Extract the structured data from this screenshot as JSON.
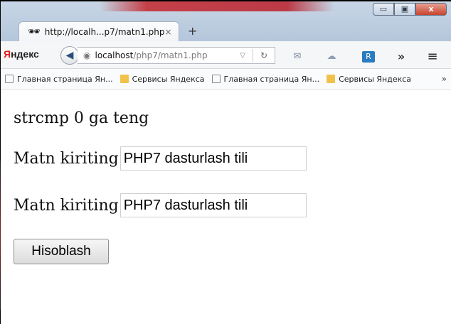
{
  "tab": {
    "title": "http://localh...p7/matn1.php",
    "close": "×",
    "new_tab": "+"
  },
  "window_controls": {
    "minimize": "▭",
    "maximize": "▣",
    "close": "x"
  },
  "navbar": {
    "brand": "Я",
    "brand_rest": "ндекс",
    "url_host": "localhost",
    "url_path": "/php7/matn1.php",
    "more": "»",
    "menu": "≡"
  },
  "bookmarks": [
    {
      "label": "Главная страница Ян...",
      "type": "page"
    },
    {
      "label": "Сервисы Яндекса",
      "type": "folder"
    },
    {
      "label": "Главная страница Ян...",
      "type": "page"
    },
    {
      "label": "Сервисы Яндекса",
      "type": "folder"
    }
  ],
  "bookmarks_more": "»",
  "page": {
    "message": "strcmp 0 ga teng",
    "field1_label": "Matn kiriting",
    "field1_value": "PHP7 dasturlash tili",
    "field2_label": "Matn kiriting",
    "field2_value": "PHP7 dasturlash tili",
    "submit_label": "Hisoblash"
  },
  "colors": {
    "brand_red": "#e01a1a",
    "folder": "#f1c24b"
  }
}
